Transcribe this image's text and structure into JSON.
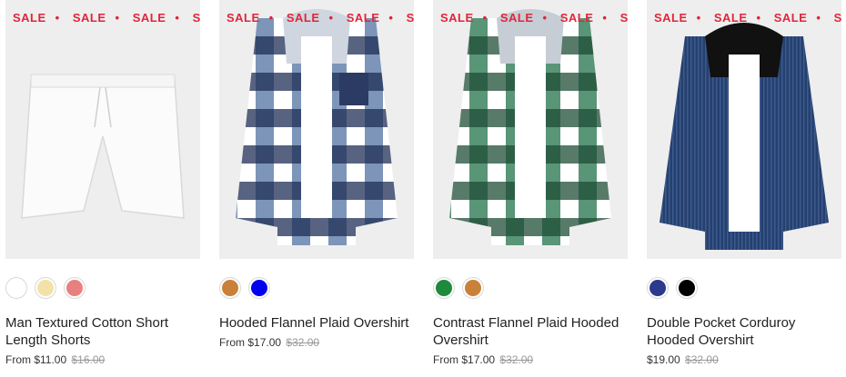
{
  "sale_label": "SALE",
  "sale_separator": "•",
  "products": [
    {
      "name": "Man Textured Cotton Short Length Shorts",
      "price_prefix": "From",
      "price": "$11.00",
      "compare_price": "$16.00",
      "swatch_colors": [
        "#ffffff",
        "#f3e2a8",
        "#e98080"
      ]
    },
    {
      "name": "Hooded Flannel Plaid Overshirt",
      "price_prefix": "From",
      "price": "$17.00",
      "compare_price": "$32.00",
      "swatch_colors": [
        "#c9813a",
        "#0000ee"
      ]
    },
    {
      "name": "Contrast Flannel Plaid Hooded Overshirt",
      "price_prefix": "From",
      "price": "$17.00",
      "compare_price": "$32.00",
      "swatch_colors": [
        "#1e8a3c",
        "#c9813a"
      ]
    },
    {
      "name": "Double Pocket Corduroy Hooded Overshirt",
      "price_prefix": "",
      "price": "$19.00",
      "compare_price": "$32.00",
      "swatch_colors": [
        "#2b3a8c",
        "#000000"
      ]
    }
  ],
  "colors": {
    "sale_red": "#e0263a",
    "card_bg": "#eeeeee"
  }
}
